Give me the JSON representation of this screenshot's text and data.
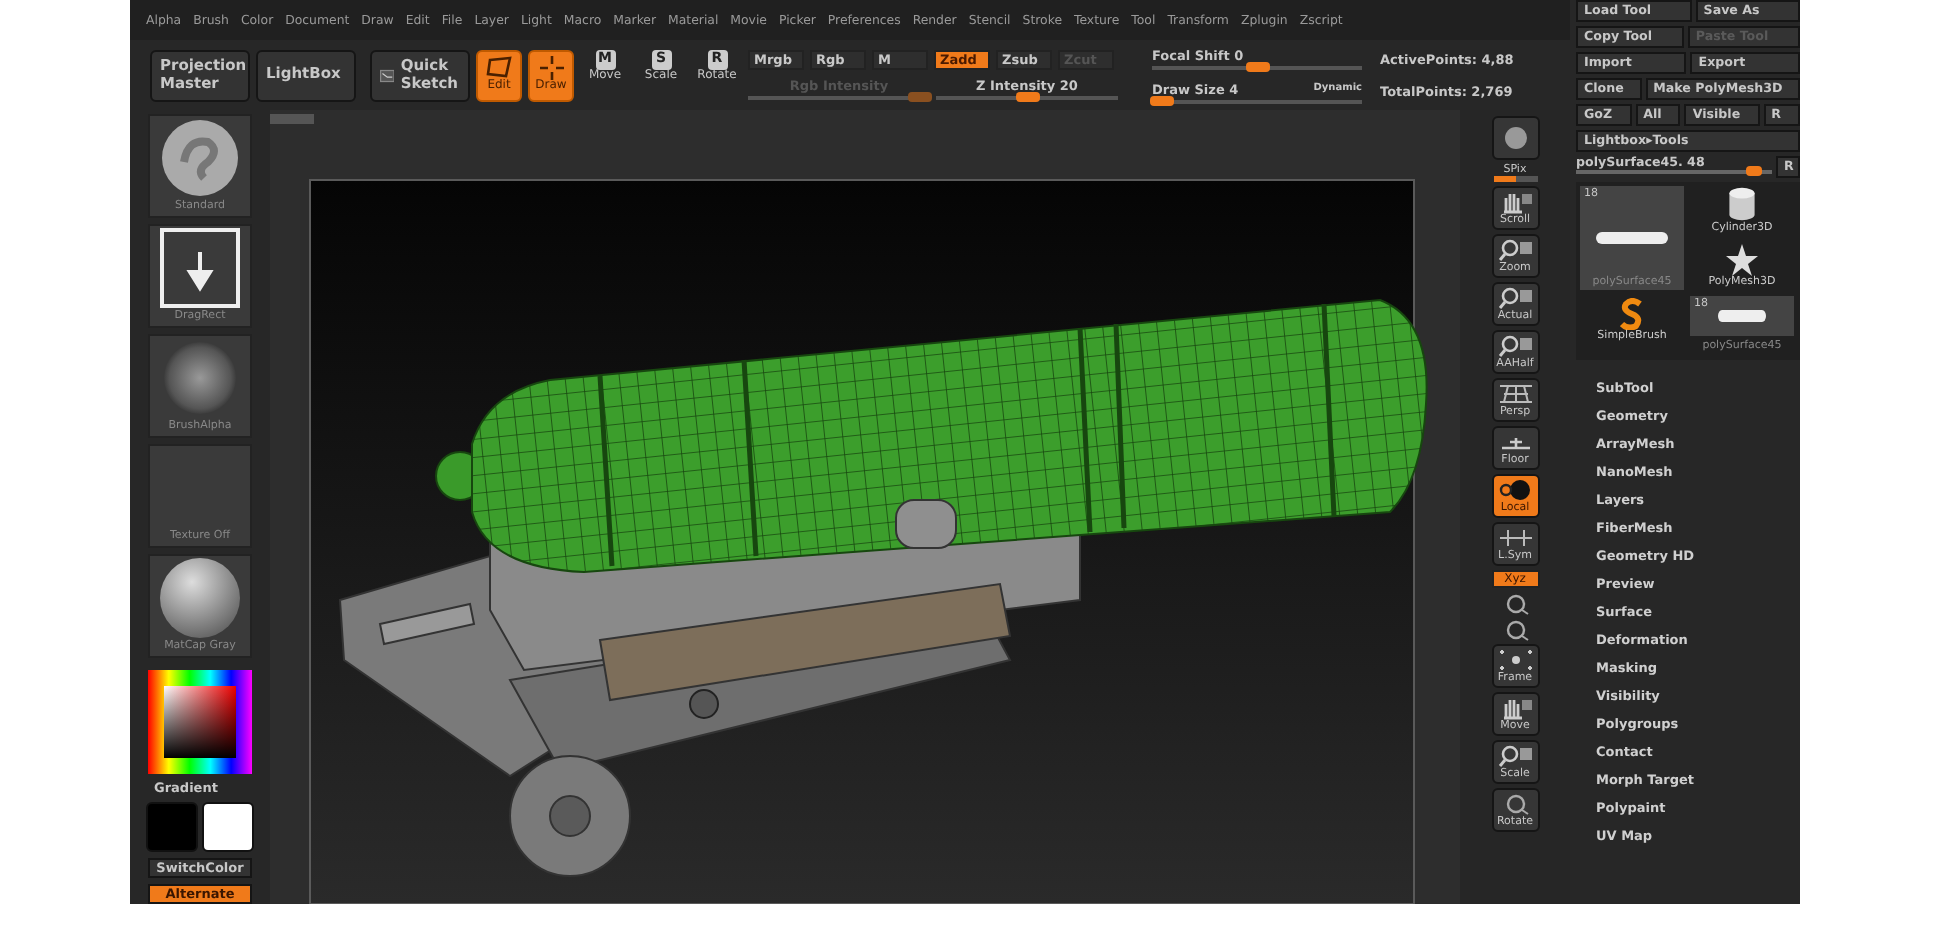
{
  "menu_bar": [
    "Alpha",
    "Brush",
    "Color",
    "Document",
    "Draw",
    "Edit",
    "File",
    "Layer",
    "Light",
    "Macro",
    "Marker",
    "Material",
    "Movie",
    "Picker",
    "Preferences",
    "Render",
    "Stencil",
    "Stroke",
    "Texture",
    "Tool",
    "Transform",
    "Zplugin",
    "Zscript"
  ],
  "toolbar": {
    "buttons": [
      {
        "label": "Projection Master",
        "kind": "text",
        "selected": false
      },
      {
        "label": "LightBox",
        "kind": "text",
        "selected": false
      },
      {
        "label": "Quick Sketch",
        "kind": "sketch",
        "selected": false
      },
      {
        "label": "Edit",
        "kind": "edit",
        "selected": true
      },
      {
        "label": "Draw",
        "kind": "draw",
        "selected": true
      },
      {
        "label": "Move",
        "kind": "letter",
        "glyph": "M",
        "selected": false
      },
      {
        "label": "Scale",
        "kind": "letter",
        "glyph": "S",
        "selected": false
      },
      {
        "label": "Rotate",
        "kind": "letter",
        "glyph": "R",
        "selected": false
      }
    ],
    "channels": [
      {
        "label": "Mrgb",
        "selected": false,
        "disabled": false
      },
      {
        "label": "Rgb",
        "selected": false,
        "disabled": false
      },
      {
        "label": "M",
        "selected": false,
        "disabled": false
      },
      {
        "label": "Zadd",
        "selected": true,
        "disabled": false
      },
      {
        "label": "Zsub",
        "selected": false,
        "disabled": false
      },
      {
        "label": "Zcut",
        "selected": false,
        "disabled": true
      }
    ],
    "intensity_sliders": [
      {
        "label": "Rgb Intensity",
        "disabled": true,
        "level": 0.95
      },
      {
        "label": "Z Intensity 20",
        "disabled": false,
        "level": 0.5
      }
    ],
    "brush_sliders": [
      {
        "label": "Focal Shift 0",
        "level": 0.5
      },
      {
        "label": "Draw Size 4",
        "level": 0.05,
        "toggle": "Dynamic"
      }
    ],
    "stats": [
      "ActivePoints: 4,88",
      "TotalPoints: 2,769"
    ]
  },
  "left_shelf": {
    "thumbnails": [
      {
        "label": "Standard",
        "kind": "brush"
      },
      {
        "label": "DragRect",
        "kind": "stroke"
      },
      {
        "label": "BrushAlpha",
        "kind": "alpha"
      },
      {
        "label": "Texture Off",
        "kind": "texture"
      },
      {
        "label": "MatCap Gray",
        "kind": "material"
      }
    ],
    "gradient_label": "Gradient",
    "swatches": [
      {
        "color": "#000000"
      },
      {
        "color": "#ffffff"
      }
    ],
    "switch_button": "SwitchColor",
    "alternate": {
      "label": "Alternate",
      "selected": true
    }
  },
  "right_shelf": [
    {
      "kind": "button",
      "selected": false
    },
    {
      "kind": "slider",
      "label": "SPix",
      "level": 0.5
    },
    {
      "kind": "button",
      "label": "Scroll",
      "selected": false
    },
    {
      "kind": "button",
      "label": "Zoom",
      "selected": false
    },
    {
      "kind": "button",
      "label": "Actual",
      "selected": false
    },
    {
      "kind": "button",
      "label": "AAHalf",
      "selected": false
    },
    {
      "kind": "button",
      "label": "Persp",
      "selected": false
    },
    {
      "kind": "button",
      "label": "Floor",
      "selected": false
    },
    {
      "kind": "button",
      "label": "Local",
      "selected": true
    },
    {
      "kind": "button",
      "label": "L.Sym",
      "selected": false
    },
    {
      "kind": "small",
      "label": "Xyz",
      "selected": true
    },
    {
      "kind": "icon"
    },
    {
      "kind": "icon"
    },
    {
      "kind": "button",
      "label": "Frame",
      "selected": false
    },
    {
      "kind": "button",
      "label": "Move",
      "selected": false
    },
    {
      "kind": "button",
      "label": "Scale",
      "selected": false
    },
    {
      "kind": "button",
      "label": "Rotate",
      "selected": false
    }
  ],
  "tool_panel": {
    "button_rows": [
      [
        {
          "label": "Load Tool",
          "disabled": false
        },
        {
          "label": "Save As",
          "disabled": false
        }
      ],
      [
        {
          "label": "Copy Tool",
          "disabled": false
        },
        {
          "label": "Paste Tool",
          "disabled": true
        }
      ],
      [
        {
          "label": "Import",
          "disabled": false
        },
        {
          "label": "Export",
          "disabled": false
        }
      ],
      [
        {
          "label": "Clone",
          "disabled": false
        },
        {
          "label": "Make PolyMesh3D",
          "disabled": false
        }
      ],
      [
        {
          "label": "GoZ",
          "disabled": false
        },
        {
          "label": "All",
          "disabled": false
        },
        {
          "label": "Visible",
          "disabled": false
        },
        {
          "label": "R",
          "disabled": false
        }
      ],
      [
        {
          "label": "Lightbox▸Tools",
          "disabled": false
        }
      ]
    ],
    "subtool_slider": {
      "label": "polySurface45. 48",
      "level": 0.95,
      "button": "R"
    },
    "thumbnails": [
      {
        "label": "polySurface45",
        "count": "18",
        "kind": "large"
      },
      {
        "label": "Cylinder3D",
        "kind": "cylinder"
      },
      {
        "label": "PolyMesh3D",
        "kind": "star"
      },
      {
        "label": "SimpleBrush",
        "kind": "brush"
      },
      {
        "label": "polySurface45",
        "count": "18",
        "kind": "small"
      }
    ],
    "subpalettes": [
      "SubTool",
      "Geometry",
      "ArrayMesh",
      "NanoMesh",
      "Layers",
      "FiberMesh",
      "Geometry HD",
      "Preview",
      "Surface",
      "Deformation",
      "Masking",
      "Visibility",
      "Polygroups",
      "Contact",
      "Morph Target",
      "Polypaint",
      "UV Map"
    ]
  }
}
